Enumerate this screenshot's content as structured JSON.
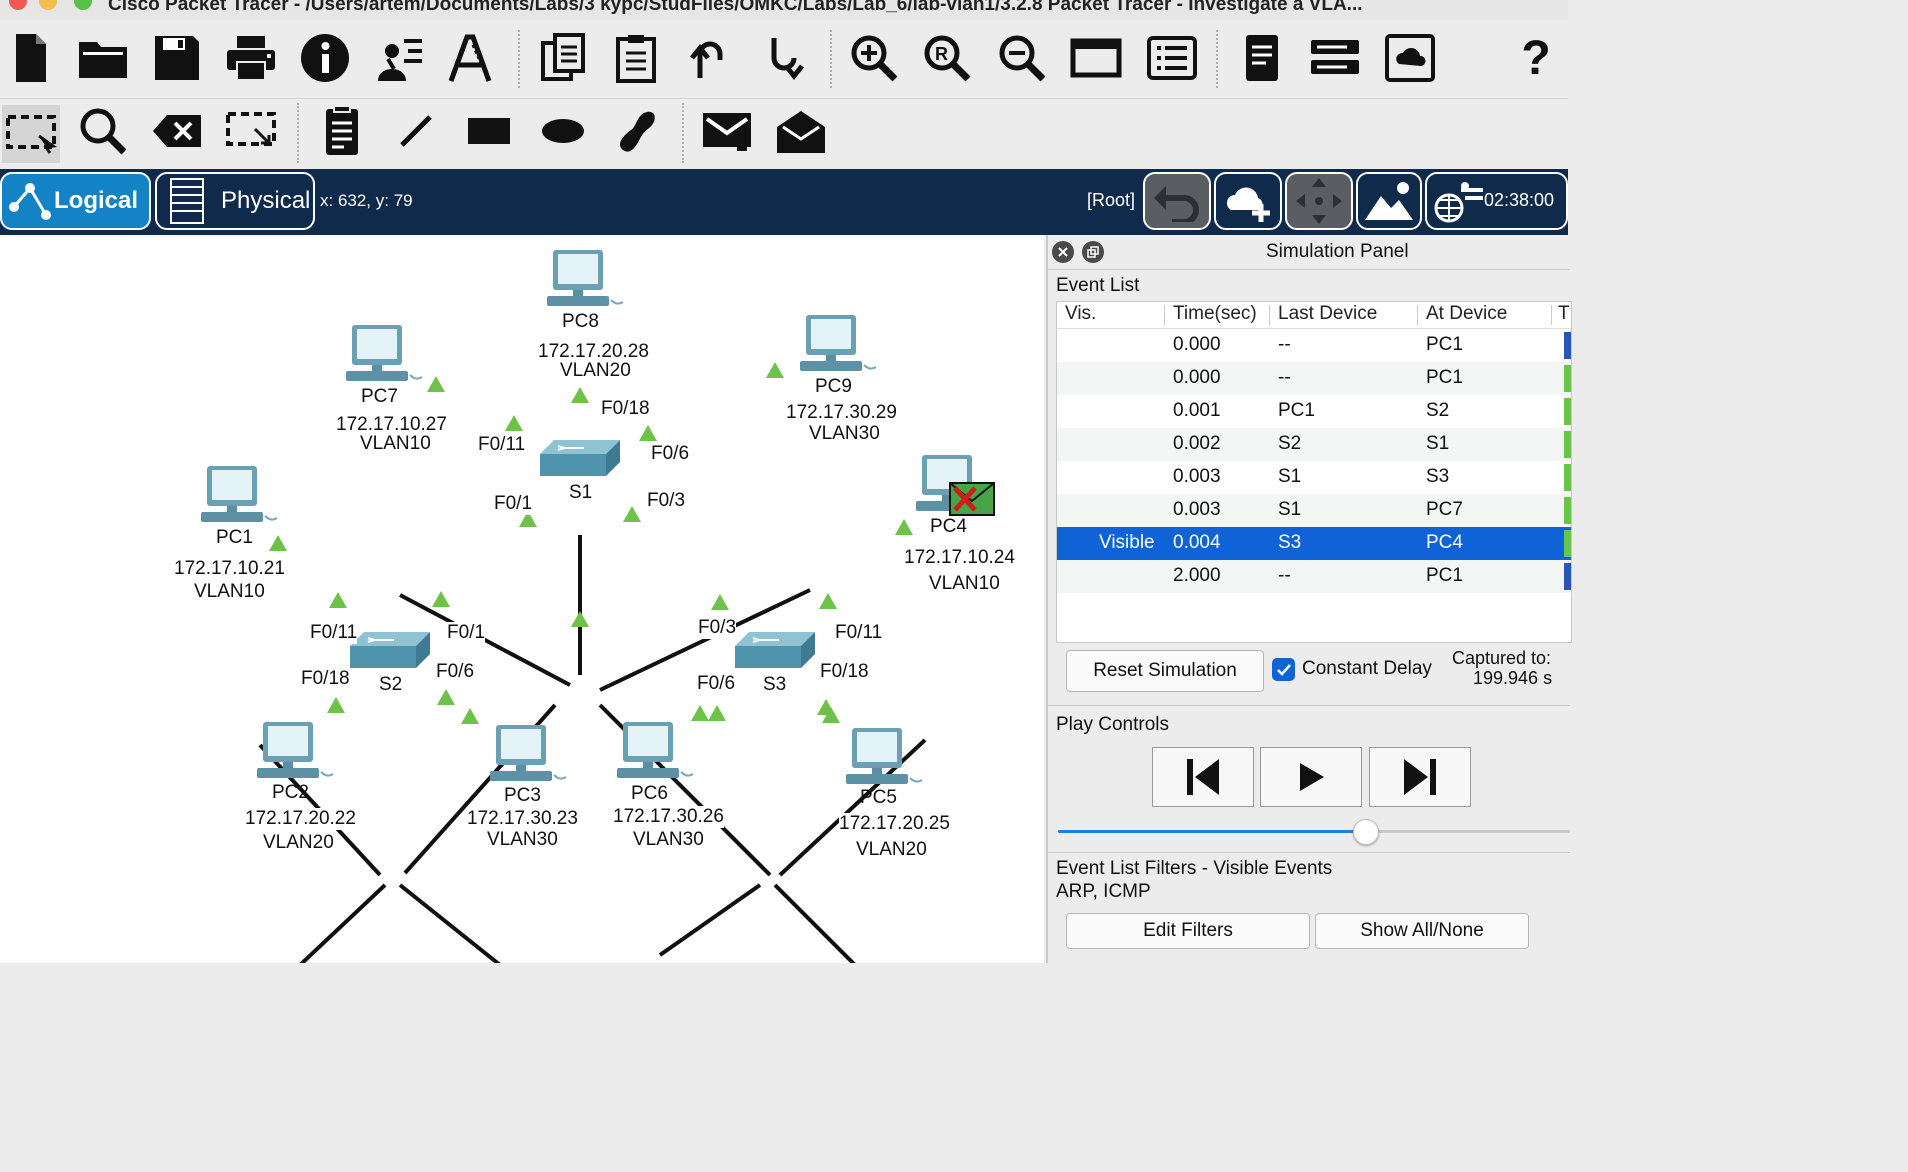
{
  "window": {
    "title": "Cisco Packet Tracer - /Users/artem/Documents/Labs/3 kypc/StudFiles/OMKC/Labs/Lab_6/lab-vlan1/3.2.8 Packet Tracer - Investigate a VLA..."
  },
  "colors": {
    "accent": "#0f63d6",
    "nav_bg": "#102a4c",
    "link": "#2c2c2c",
    "port_up": "#6dc24a",
    "switch": "#4f93ac"
  },
  "toolbar1": {
    "icons": [
      "new-file-icon",
      "open-folder-icon",
      "save-icon",
      "print-icon",
      "info-icon",
      "activity-wizard-icon",
      "custom-pdu-icon",
      "copy-icon",
      "paste-icon",
      "undo-icon",
      "redo-icon",
      "zoom-in-icon",
      "zoom-reset-icon",
      "zoom-out-icon",
      "window-icon",
      "palette-icon",
      "notes-icon",
      "device-icon",
      "cluster-icon",
      "help-icon"
    ]
  },
  "toolbar2": {
    "icons": [
      "select-icon",
      "inspect-icon",
      "delete-icon",
      "resize-icon",
      "note-icon",
      "line-icon",
      "rectangle-icon",
      "ellipse-icon",
      "freeform-icon",
      "simple-pdu-icon",
      "complex-pdu-icon"
    ]
  },
  "nav": {
    "logical": "Logical",
    "physical": "Physical",
    "coords": "x: 632, y: 79",
    "root": "[Root]",
    "time": "02:38:00"
  },
  "topology": {
    "devices": [
      {
        "name": "PC8",
        "ip": "172.17.20.28",
        "vlan": "VLAN20"
      },
      {
        "name": "PC7",
        "ip": "172.17.10.27",
        "vlan": "VLAN10"
      },
      {
        "name": "PC9",
        "ip": "172.17.30.29",
        "vlan": "VLAN30"
      },
      {
        "name": "PC1",
        "ip": "172.17.10.21",
        "vlan": "VLAN10"
      },
      {
        "name": "PC4",
        "ip": "172.17.10.24",
        "vlan": "VLAN10"
      },
      {
        "name": "PC2",
        "ip": "172.17.20.22",
        "vlan": "VLAN20"
      },
      {
        "name": "PC3",
        "ip": "172.17.30.23",
        "vlan": "VLAN30"
      },
      {
        "name": "PC6",
        "ip": "172.17.30.26",
        "vlan": "VLAN30"
      },
      {
        "name": "PC5",
        "ip": "172.17.20.25",
        "vlan": "VLAN20"
      }
    ],
    "switches": [
      "S1",
      "S2",
      "S3"
    ],
    "ports": {
      "s1_f018": "F0/18",
      "s1_f011": "F0/11",
      "s1_f06": "F0/6",
      "s1_f01": "F0/1",
      "s1_f03": "F0/3",
      "s2_f011": "F0/11",
      "s2_f01": "F0/1",
      "s2_f018": "F0/18",
      "s2_f06": "F0/6",
      "s3_f03": "F0/3",
      "s3_f011": "F0/11",
      "s3_f06": "F0/6",
      "s3_f018": "F0/18"
    }
  },
  "sim": {
    "title": "Simulation Panel",
    "event_list": "Event List",
    "columns": [
      "Vis.",
      "Time(sec)",
      "Last Device",
      "At Device",
      "T"
    ],
    "events": [
      {
        "vis": "",
        "time": "0.000",
        "last": "--",
        "at": "PC1",
        "color": "#2a55b4"
      },
      {
        "vis": "",
        "time": "0.000",
        "last": "--",
        "at": "PC1",
        "color": "#6dc24a"
      },
      {
        "vis": "",
        "time": "0.001",
        "last": "PC1",
        "at": "S2",
        "color": "#6dc24a"
      },
      {
        "vis": "",
        "time": "0.002",
        "last": "S2",
        "at": "S1",
        "color": "#6dc24a"
      },
      {
        "vis": "",
        "time": "0.003",
        "last": "S1",
        "at": "S3",
        "color": "#6dc24a"
      },
      {
        "vis": "",
        "time": "0.003",
        "last": "S1",
        "at": "PC7",
        "color": "#6dc24a"
      },
      {
        "vis": "Visible",
        "time": "0.004",
        "last": "S3",
        "at": "PC4",
        "color": "#6dc24a"
      },
      {
        "vis": "",
        "time": "2.000",
        "last": "--",
        "at": "PC1",
        "color": "#2a55b4"
      }
    ],
    "selected_row": 6,
    "reset": "Reset Simulation",
    "constant_delay": "Constant Delay",
    "captured_label": "Captured to:",
    "captured_value": "199.946 s",
    "play_controls": "Play Controls",
    "speed": 0.62,
    "filters_title": "Event List Filters - Visible Events",
    "filters_value": "ARP, ICMP",
    "edit_filters": "Edit Filters",
    "show_all": "Show All/None"
  }
}
